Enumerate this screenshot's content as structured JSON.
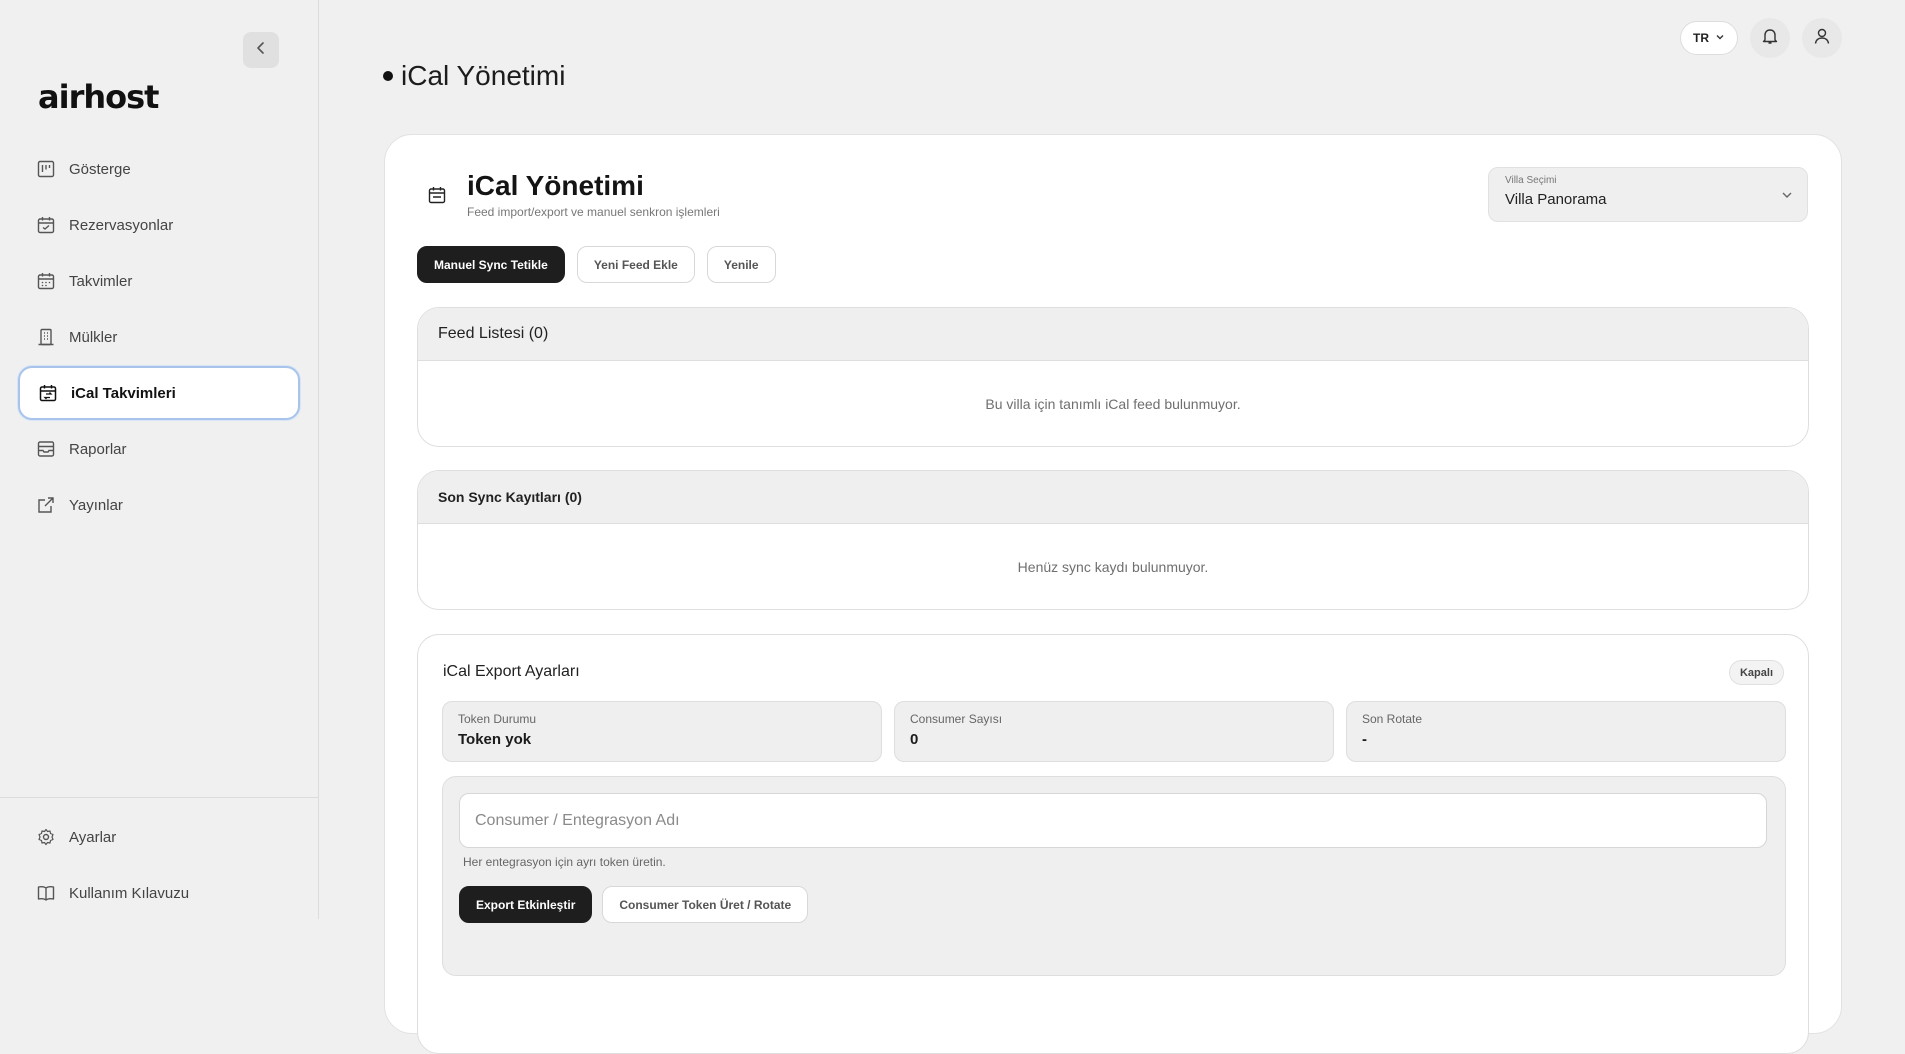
{
  "app": {
    "logo_text": "airhost",
    "language": "TR"
  },
  "sidebar": {
    "items": [
      {
        "label": "Gösterge",
        "icon": "dashboard-icon"
      },
      {
        "label": "Rezervasyonlar",
        "icon": "calendar-check-icon"
      },
      {
        "label": "Takvimler",
        "icon": "calendar-icon"
      },
      {
        "label": "Mülkler",
        "icon": "building-icon"
      },
      {
        "label": "iCal Takvimleri",
        "icon": "calendar-sync-icon",
        "active": true
      },
      {
        "label": "Raporlar",
        "icon": "inbox-icon"
      },
      {
        "label": "Yayınlar",
        "icon": "external-link-icon"
      }
    ],
    "bottom_items": [
      {
        "label": "Ayarlar",
        "icon": "gear-icon"
      },
      {
        "label": "Kullanım Kılavuzu",
        "icon": "book-icon"
      }
    ]
  },
  "page": {
    "title": "iCal Yönetimi"
  },
  "card": {
    "title": "iCal Yönetimi",
    "subtitle": "Feed import/export ve manuel senkron işlemleri",
    "villa_select": {
      "label": "Villa Seçimi",
      "value": "Villa Panorama"
    },
    "actions": {
      "manual_sync": "Manuel Sync Tetikle",
      "add_feed": "Yeni Feed Ekle",
      "refresh": "Yenile"
    },
    "feed_list": {
      "title": "Feed Listesi (0)",
      "empty": "Bu villa için tanımlı iCal feed bulunmuyor."
    },
    "sync_logs": {
      "title": "Son Sync Kayıtları (0)",
      "empty": "Henüz sync kaydı bulunmuyor."
    },
    "export": {
      "title": "iCal Export Ayarları",
      "status_badge": "Kapalı",
      "stats": [
        {
          "label": "Token Durumu",
          "value": "Token yok"
        },
        {
          "label": "Consumer Sayısı",
          "value": "0"
        },
        {
          "label": "Son Rotate",
          "value": "-"
        }
      ],
      "consumer_placeholder": "Consumer / Entegrasyon Adı",
      "hint": "Her entegrasyon için ayrı token üretin.",
      "enable_button": "Export Etkinleştir",
      "rotate_button": "Consumer Token Üret / Rotate"
    }
  },
  "colors": {
    "background": "#f0f0f0",
    "accent_dark": "#1e1e1e",
    "active_border": "#a9c4ea"
  }
}
